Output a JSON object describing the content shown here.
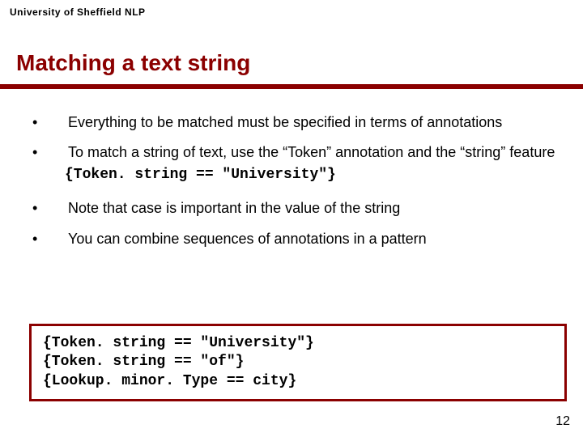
{
  "header": {
    "label": "University of Sheffield NLP"
  },
  "title": "Matching a text string",
  "bullets": {
    "b1": "Everything to be matched must be specified in terms of annotations",
    "b2": "To match a string of text, use the “Token” annotation and the “string” feature",
    "b2_code": "{Token. string == \"University\"}",
    "b3": "Note that case is important in the value of the string",
    "b4": "You can combine sequences of annotations in a pattern"
  },
  "code_block": "{Token. string == \"University\"}\n{Token. string == \"of\"}\n{Lookup. minor. Type == city}",
  "page_number": "12",
  "dot": "•"
}
